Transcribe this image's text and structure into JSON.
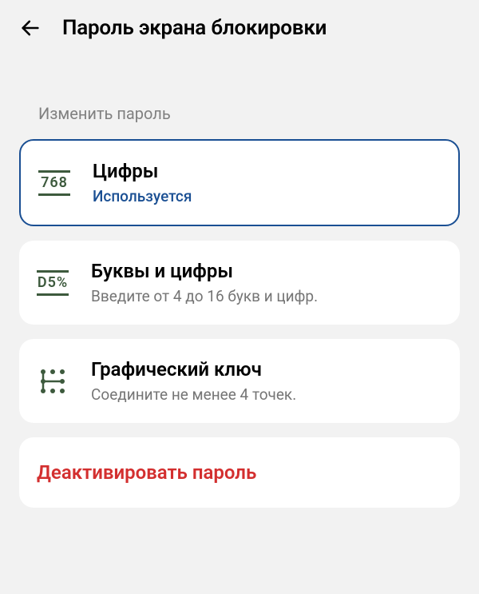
{
  "header": {
    "title": "Пароль экрана блокировки"
  },
  "section_label": "Изменить пароль",
  "options": [
    {
      "title": "Цифры",
      "subtitle": "Используется",
      "icon_text": "768",
      "active": true
    },
    {
      "title": "Буквы и цифры",
      "subtitle": "Введите от 4 до 16 букв и цифр.",
      "icon_text": "D5%",
      "active": false
    },
    {
      "title": "Графический ключ",
      "subtitle": "Соедините не менее 4 точек.",
      "active": false
    }
  ],
  "deactivate_label": "Деактивировать пароль"
}
